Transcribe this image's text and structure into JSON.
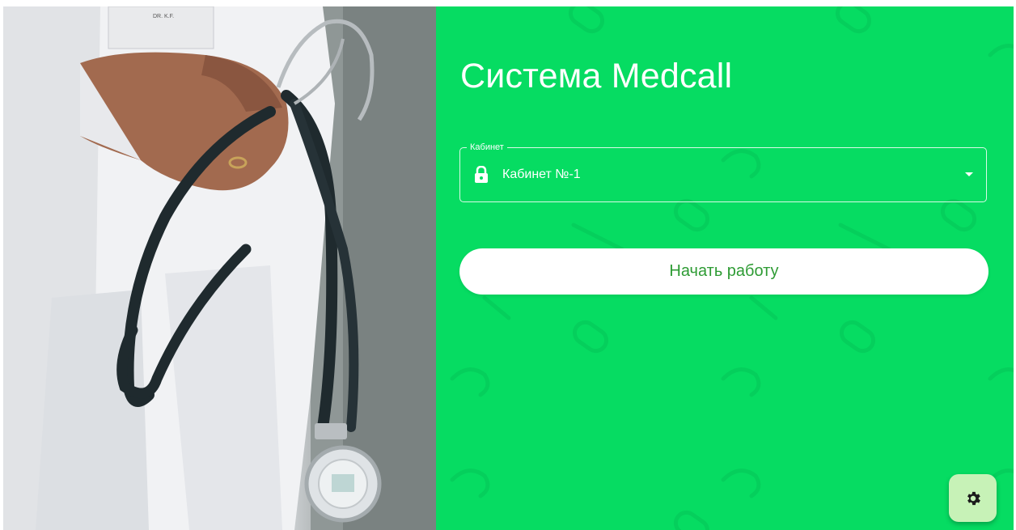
{
  "app": {
    "title": "Система Medcall"
  },
  "cabinet_select": {
    "label": "Кабинет",
    "selected_value": "Кабинет №-1",
    "icon": "lock-icon"
  },
  "actions": {
    "start_label": "Начать работу",
    "settings_icon": "gear-icon"
  },
  "theme": {
    "accent": "#06dc62",
    "button_text": "#2e9b34",
    "settings_bg": "#c7f2b7"
  }
}
